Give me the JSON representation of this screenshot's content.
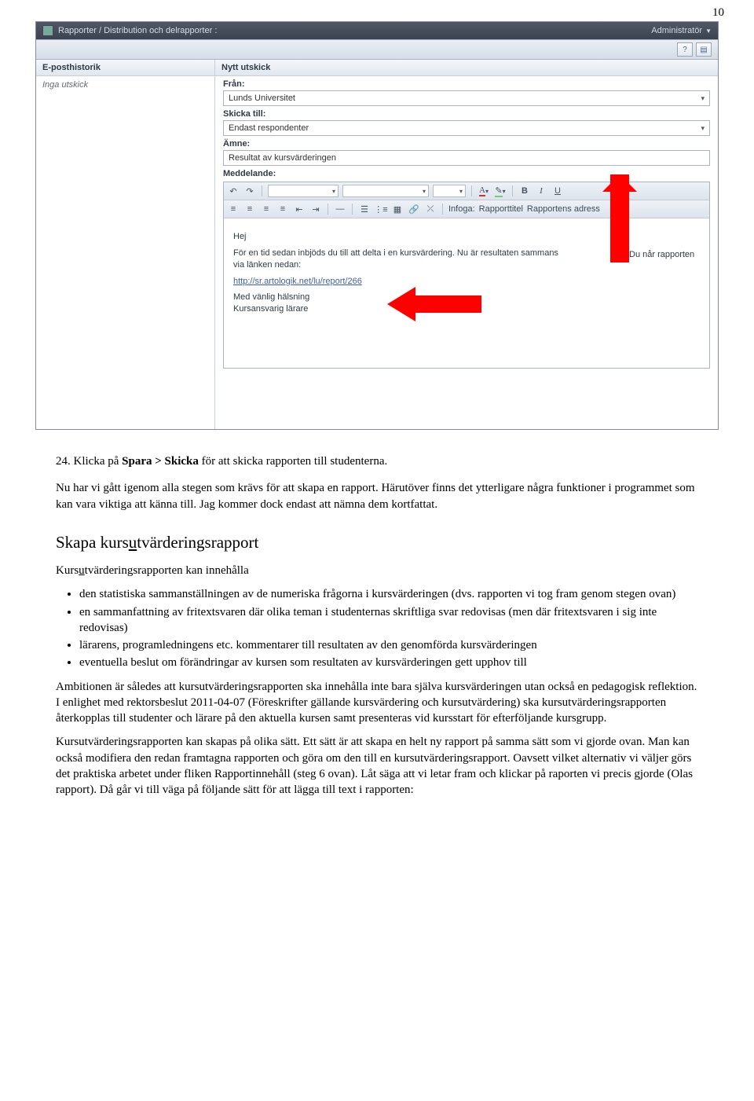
{
  "page_number": "10",
  "app": {
    "breadcrumb": "Rapporter / Distribution och delrapporter :",
    "admin_label": "Administratör",
    "help_icon_label": "?"
  },
  "left_col": {
    "header": "E-posthistorik",
    "empty": "Inga utskick"
  },
  "right_col": {
    "header": "Nytt utskick",
    "from_label": "Från:",
    "from_value": "Lunds Universitet",
    "to_label": "Skicka till:",
    "to_value": "Endast respondenter",
    "subject_label": "Ämne:",
    "subject_value": "Resultat av kursvärderingen",
    "message_label": "Meddelande:",
    "toolbar2": {
      "infoga": "Infoga:",
      "btn1": "Rapporttitel",
      "btn2": "Rapportens adress"
    },
    "body": {
      "greeting": "Hej",
      "para1_a": "För en tid sedan inbjöds du till att delta i en kursvärdering. Nu är resultaten sammans",
      "para1_b": "via länken nedan:",
      "link": "http://sr.artologik.net/lu/report/266",
      "signoff1": "Med vänlig hälsning",
      "signoff2": "Kursansvarig lärare",
      "side_note": "Du når rapporten"
    }
  },
  "doc": {
    "step_line_prefix": "24. Klicka på ",
    "step_bold": "Spara > Skicka",
    "step_line_suffix": " för att skicka rapporten till studenterna.",
    "para_intro": "Nu har vi gått igenom alla stegen som krävs för att skapa en rapport. Härutöver finns det ytterligare några funktioner i programmet som kan vara viktiga att känna till. Jag kommer dock endast att nämna dem kortfattat.",
    "subhead_pre": "Skapa kurs",
    "subhead_u": "u",
    "subhead_post": "tvärderingsrapport",
    "list_intro_pre": "Kurs",
    "list_intro_u": "u",
    "list_intro_post": "tvärderingsrapporten kan innehålla",
    "bullets": [
      "den statistiska sammanställningen av de numeriska frågorna i kursvärderingen (dvs. rapporten vi tog fram genom stegen ovan)",
      "en sammanfattning av fritextsvaren där olika teman i studenternas skriftliga svar redovisas (men där fritextsvaren i sig inte redovisas)",
      "lärarens, programledningens etc. kommentarer till resultaten av den genomförda kursvärderingen",
      "eventuella beslut om förändringar av kursen som resultaten av kursvärderingen gett upphov till"
    ],
    "para2": "Ambitionen är således att kursutvärderingsrapporten ska innehålla inte bara själva kursvärderingen utan också en pedagogisk reflektion. I enlighet med rektorsbeslut 2011-04-07 (Föreskrifter gällande kursvärdering och kursutvärdering) ska kursutvärderingsrapporten återkopplas till studenter och lärare på den aktuella kursen samt presenteras vid kursstart för efterföljande kursgrupp.",
    "para3": "Kursutvärderingsrapporten kan skapas på olika sätt. Ett sätt är att skapa en helt ny rapport på samma sätt som vi gjorde ovan. Man kan också modifiera den redan framtagna rapporten och göra om den till en kursutvärderingsrapport. Oavsett vilket alternativ vi väljer görs det praktiska arbetet under fliken Rapportinnehåll (steg 6 ovan). Låt säga att vi letar fram och klickar på raporten vi precis gjorde (Olas rapport). Då går vi till väga på följande sätt för att lägga till text i rapporten:"
  }
}
